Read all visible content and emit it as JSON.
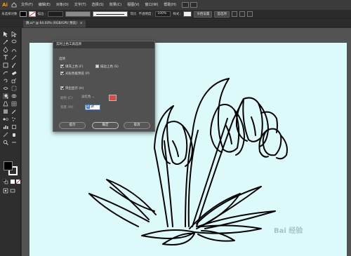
{
  "app": {
    "logo": "Ai"
  },
  "menubar": {
    "items": [
      "文件(F)",
      "编辑(E)",
      "对象(O)",
      "文字(T)",
      "选择(S)",
      "效果(C)",
      "视图(V)",
      "窗口(W)",
      "帮助(H)"
    ]
  },
  "controlbar": {
    "selection_label": "未选择对象",
    "stroke_label": "描边 :",
    "stroke_value": "",
    "stroke_style_label": "等比",
    "opacity_label": "不透明度 :",
    "opacity_value": "100%",
    "style_label": "样式 :",
    "doc_setup_button": "文档设置",
    "prefs_button": "首选项",
    "fill_color": "#000000"
  },
  "document_tab": {
    "title": "跳.ai* @ 64.03% (RGB/GPU 预览)",
    "close": "×"
  },
  "toolbar": {
    "fill_color": "#000000",
    "stroke_color": "#ffffff"
  },
  "dialog": {
    "title": "实时上色工具选项",
    "section_options": "选项",
    "fill_paint_label": "填充上色 (F)",
    "fill_paint_checked": true,
    "stroke_paint_label": "描边上色 (S)",
    "stroke_paint_checked": false,
    "cursor_preview_label": "光标色板预览 (P)",
    "cursor_preview_checked": true,
    "highlight_label": "突出显示 (H)",
    "highlight_checked": true,
    "color_label": "颜色 (C):",
    "color_value": "淡红色",
    "highlight_color": "#e04848",
    "width_label": "宽度 (W):",
    "width_value": "4",
    "width_unit": "pt",
    "tips_button": "提示",
    "ok_button": "确定",
    "cancel_button": "取消"
  },
  "canvas": {
    "artboard_color": "#ddfafb",
    "background_color": "#535353"
  },
  "watermark": "Bai 经验"
}
